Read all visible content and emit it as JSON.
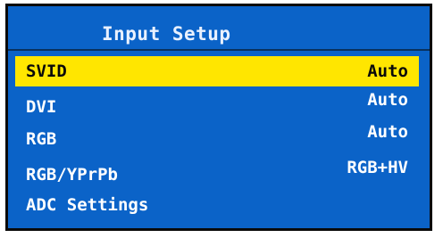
{
  "menu": {
    "title": "Input Setup",
    "items": [
      {
        "label": "SVID",
        "value": "Auto",
        "selected": true
      },
      {
        "label": "DVI",
        "value": "Auto",
        "selected": false
      },
      {
        "label": "RGB",
        "value": "Auto",
        "selected": false
      },
      {
        "label": "RGB/YPrPb",
        "value": "RGB+HV",
        "selected": false
      },
      {
        "label": "ADC Settings",
        "value": "",
        "selected": false
      }
    ]
  },
  "colors": {
    "background": "#0b63c8",
    "highlight": "#ffe600",
    "text": "#ffffff",
    "selected_text": "#0a0a0a"
  }
}
